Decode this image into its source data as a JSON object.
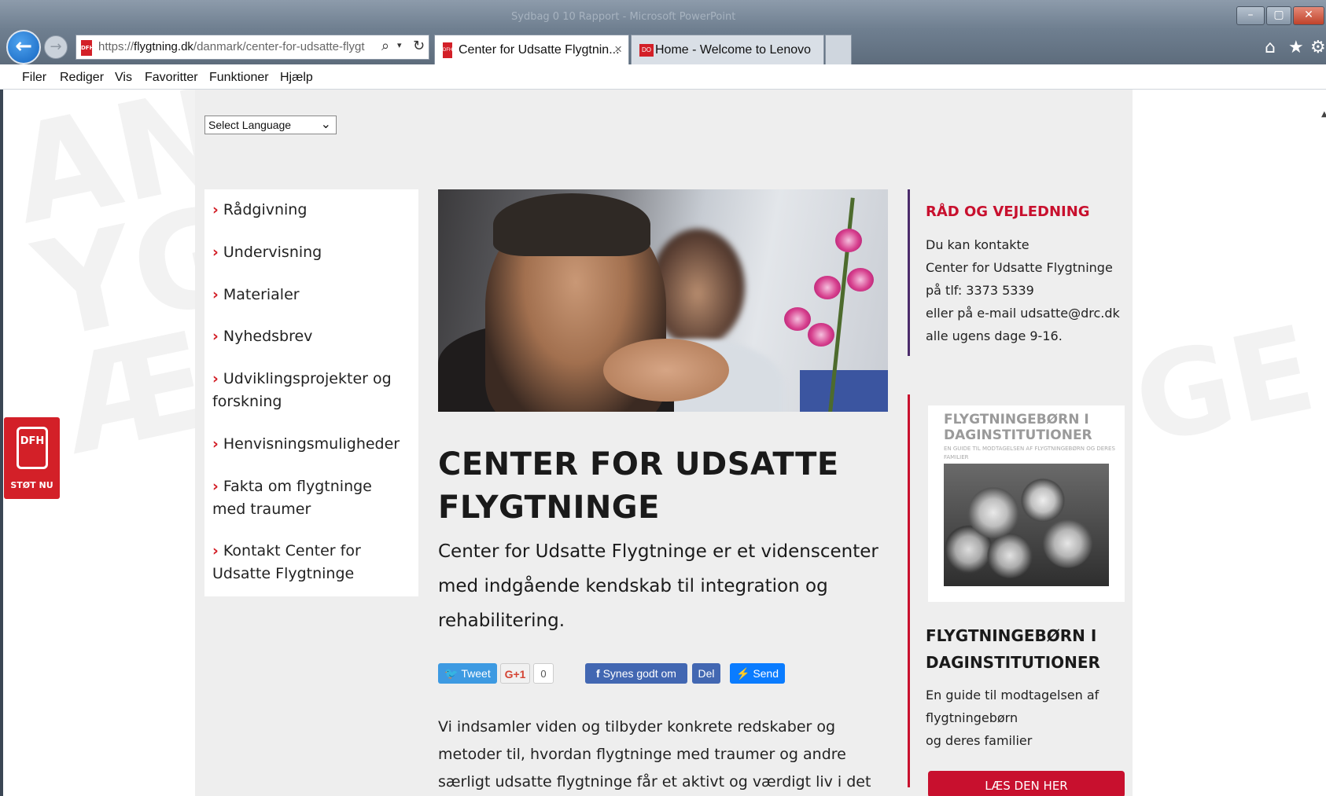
{
  "browser": {
    "window_title": "Sydbag 0 10 Rapport - Microsoft PowerPoint",
    "url_prefix": "https://",
    "url_domain": "flygtning.dk",
    "url_path": "/danmark/center-for-udsatte-flygt",
    "tabs": [
      {
        "title": "Center for Udsatte Flygtnin...",
        "close": "×",
        "favicon": "DFH"
      },
      {
        "title": "Home - Welcome to Lenovo",
        "favicon": "DO"
      }
    ],
    "menu": [
      "Filer",
      "Rediger",
      "Vis",
      "Favoritter",
      "Funktioner",
      "Hjælp"
    ],
    "icons": {
      "back": "back-arrow-icon",
      "forward": "forward-arrow-icon",
      "search": "search-icon",
      "refresh": "refresh-icon",
      "home": "home-icon",
      "favorites": "star-icon",
      "tools": "gear-icon"
    }
  },
  "language_select": {
    "value": "Select Language"
  },
  "support_badge": {
    "logo": "DFH",
    "label": "STØT NU"
  },
  "nav": [
    "Rådgivning",
    "Undervisning",
    "Materialer",
    "Nyhedsbrev",
    "Udviklingsprojekter og forskning",
    "Henvisningsmuligheder",
    "Fakta om flygtninge med traumer",
    "Kontakt Center for Udsatte Flygtninge"
  ],
  "main": {
    "title": "CENTER FOR UDSATTE FLYGTNINGE",
    "lead": "Center for Udsatte Flygtninge er et videnscenter med indgående kendskab til integration og rehabilitering.",
    "social": {
      "tweet": "Tweet",
      "gplus": "G+1",
      "gplus_count": "0",
      "fb_like": "Synes godt om",
      "fb_share": "Del",
      "messenger": "Send"
    },
    "body": "Vi indsamler viden og tilbyder konkrete redskaber og metoder til, hvordan flygtninge med traumer og andre særligt udsatte flygtninge får et aktivt og værdigt liv i det"
  },
  "advice": {
    "title": "RÅD OG VEJLEDNING",
    "lines": [
      "Du kan kontakte",
      "Center for Udsatte Flygtninge",
      "på tlf: 3373 5339",
      "eller på e-mail udsatte@drc.dk",
      "alle ugens dage 9-16."
    ]
  },
  "guide": {
    "cover_title": "FLYGTNINGEBØRN I DAGINSTITUTIONER",
    "cover_subtitle": "EN GUIDE TIL MODTAGELSEN AF FLYGTNINGEBØRN OG DERES FAMILIER",
    "title": "FLYGTNINGEBØRN I DAGINSTITUTIONER",
    "desc_lines": [
      "En guide til modtagelsen af",
      "flygtningebørn",
      "og deres familier"
    ],
    "button": "LÆS DEN HER"
  },
  "colors": {
    "accent": "#c8102e",
    "purple": "#4b2b6b",
    "panel": "#eeeeee"
  }
}
